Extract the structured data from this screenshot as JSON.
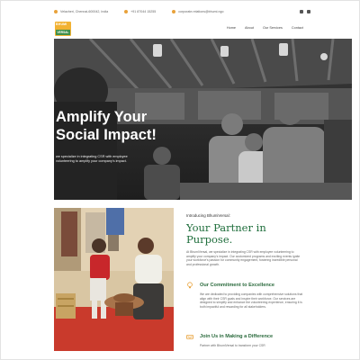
{
  "topbar": {
    "address": "Velacheri, Chennai-600042, India",
    "phone": "+91 87044 15255",
    "email": "corporate.relations@bhumi.ngo"
  },
  "logo": {
    "line1": "BHUMI",
    "line2": "VERSAL"
  },
  "nav": [
    "Home",
    "About",
    "Our Services",
    "Contact"
  ],
  "hero": {
    "title_line1": "Amplify Your",
    "title_line2": "Social Impact!",
    "subtitle": "we specialize in integrating CSR with employee volunteering to amplify your company's impact."
  },
  "intro": {
    "eyebrow": "Introducing BhumiVersal:",
    "heading_line1": "Your Partner in",
    "heading_line2": "Purpose.",
    "paragraph": "At BhumiVersal, we specialize in integrating CSR with employee volunteering to amplify your company's impact. Our customized programs and exciting events ignite your workforce's passion for community engagement, fostering incredible personal and professional growth."
  },
  "features": [
    {
      "icon": "lightbulb-icon",
      "title": "Our Commitment to Excellence",
      "text": "We are dedicated to providing companies with comprehensive solutions that align with their CSR goals and inspire their workforce. Our services are designed to simplify and enhance the volunteering experience, ensuring it is both impactful and rewarding for all stakeholders."
    },
    {
      "icon": "handshake-icon",
      "title": "Join Us in Making a Difference",
      "text": "Partner with BhumiVersal to transform your CSR"
    }
  ],
  "colors": {
    "accent": "#e8a23a",
    "brand_green": "#1f6e3c"
  }
}
